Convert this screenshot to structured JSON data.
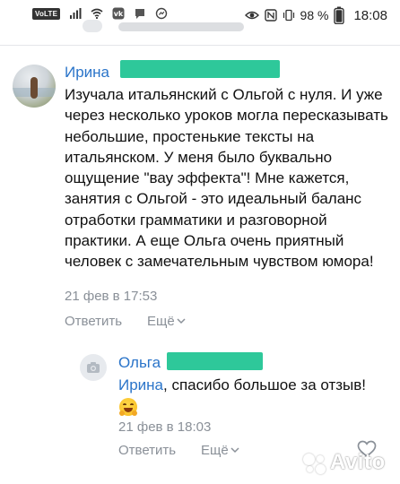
{
  "status_bar": {
    "volte": "VoLTE",
    "battery_percent": "98 %",
    "time": "18:08"
  },
  "comments": [
    {
      "author": "Ирина",
      "text": "Изучала итальянский с Ольгой с нуля. И уже через несколько уроков могла пересказывать небольшие, простенькие тексты на итальянском. У меня было буквально ощущение \"вау эффекта\"! Мне кажется, занятия с Ольгой - это идеальный баланс отработки грамматики и разговорной практики. А еще Ольга очень приятный человек с замечательным чувством юмора!",
      "timestamp": "21 фев в 17:53",
      "reply_label": "Ответить",
      "more_label": "Ещё"
    },
    {
      "author": "Ольга",
      "mention": "Ирина",
      "text": ", спасибо большое за отзыв!",
      "emoji": "hugging-face",
      "timestamp": "21 фев в 18:03",
      "reply_label": "Ответить",
      "more_label": "Ещё"
    }
  ],
  "watermark": {
    "text": "Avito"
  },
  "colors": {
    "link": "#2a74c9",
    "meta": "#8a9098",
    "redaction": "#2ec89a"
  }
}
